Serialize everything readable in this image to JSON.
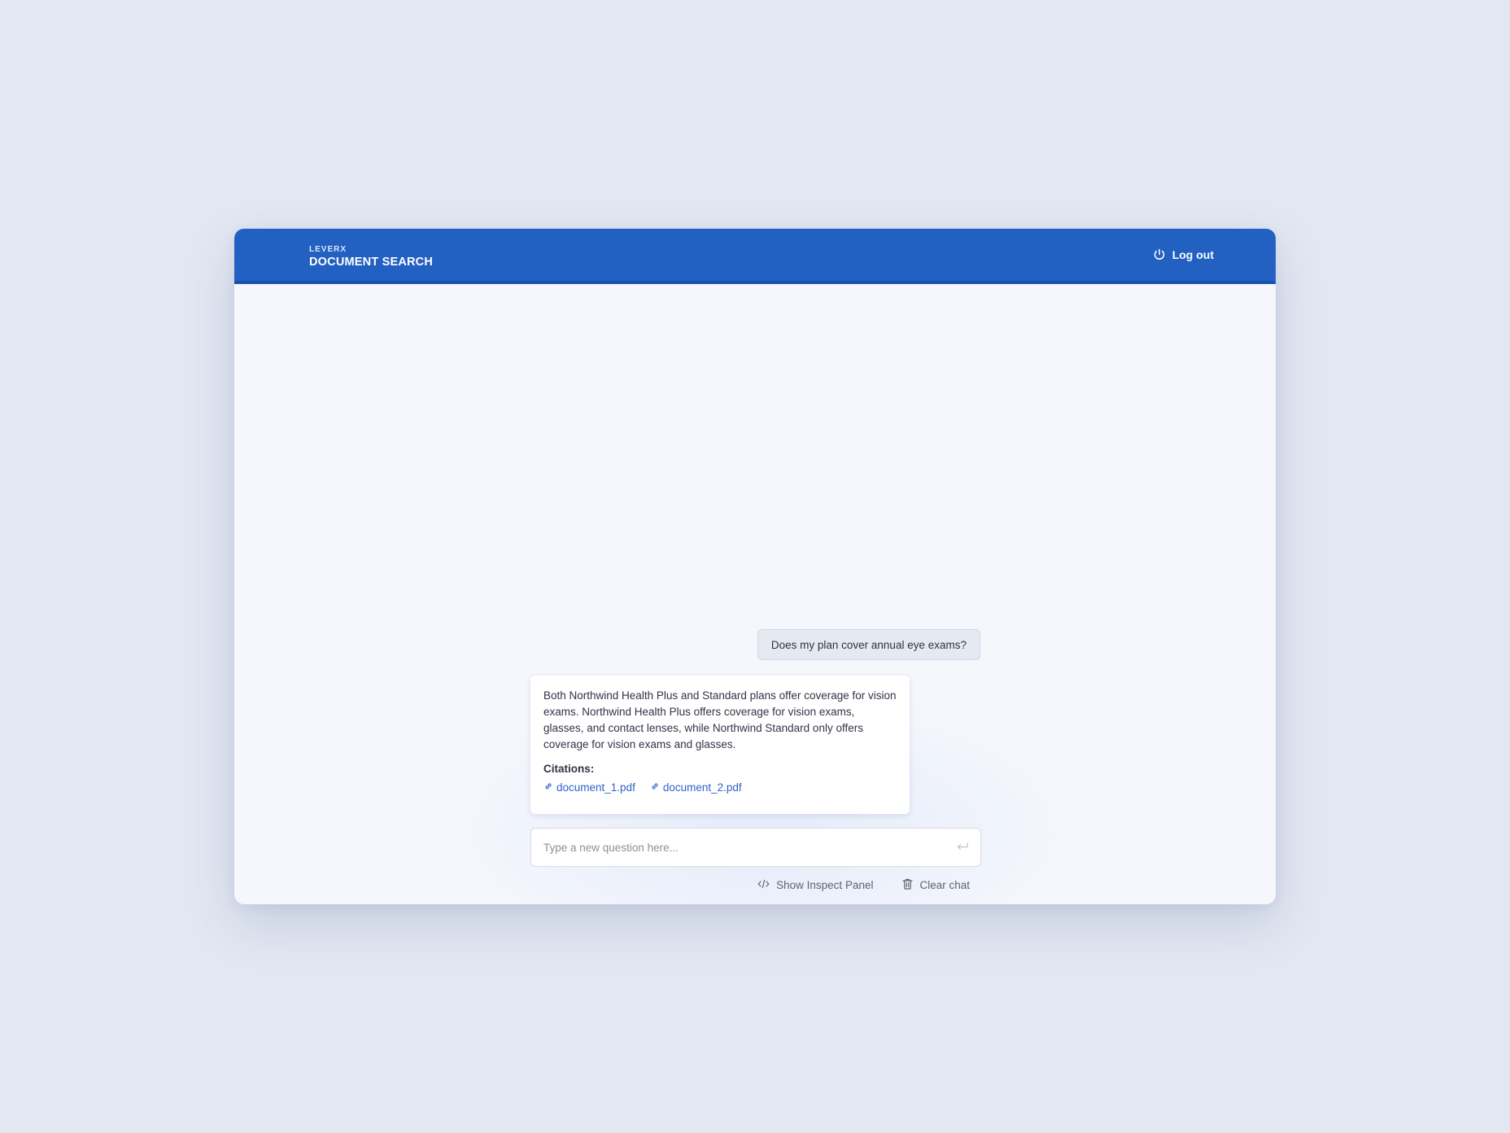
{
  "header": {
    "brand_small": "LEVERX",
    "title": "DOCUMENT SEARCH",
    "logout_label": "Log out",
    "color": "#2260c2"
  },
  "chat": {
    "question": "Does my plan cover annual eye exams?",
    "answer": "Both Northwind Health Plus and Standard plans offer coverage for vision exams. Northwind Health Plus offers coverage for vision exams, glasses, and contact lenses, while Northwind Standard only offers coverage for vision exams and glasses.",
    "citations_label": "Citations:",
    "citations": [
      {
        "label": "document_1.pdf",
        "icon": "link-icon"
      },
      {
        "label": "document_2.pdf",
        "icon": "link-icon"
      }
    ]
  },
  "input": {
    "placeholder": "Type a new question here...",
    "value": "",
    "send_icon": "enter-icon"
  },
  "actions": {
    "inspect_label": "Show Inspect Panel",
    "inspect_icon": "code-icon",
    "clear_label": "Clear chat",
    "clear_icon": "trash-icon"
  },
  "colors": {
    "accent": "#2260c2",
    "link": "#2f62c6",
    "background": "#e2e7f2"
  }
}
